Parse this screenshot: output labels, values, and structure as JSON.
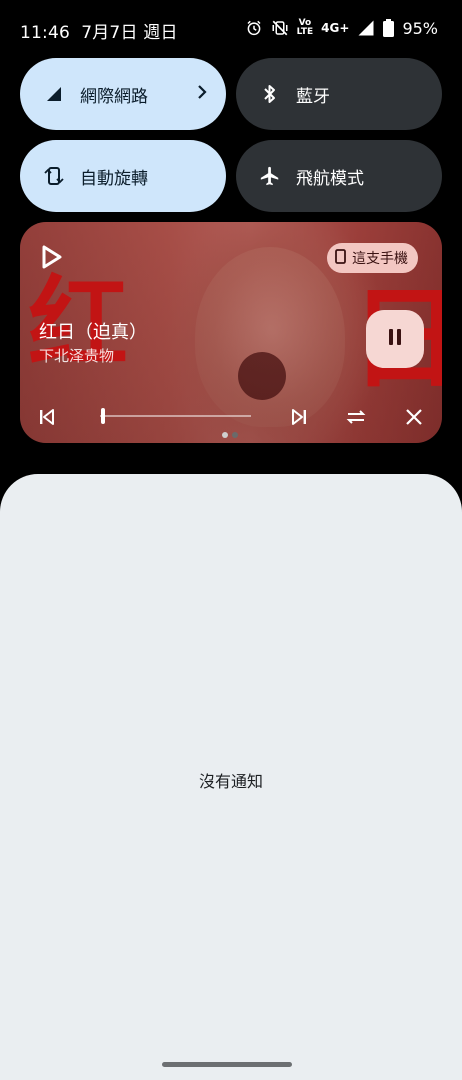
{
  "status_bar": {
    "time": "11:46",
    "date": "7月7日 週日",
    "network": "4G+",
    "battery": "95%",
    "icons": [
      "alarm-icon",
      "vibrate-off-icon",
      "volte-icon",
      "signal-icon",
      "battery-icon"
    ],
    "volte_top": "Vo",
    "volte_bottom": "LTE"
  },
  "quick_settings": {
    "tiles": [
      {
        "label": "網際網路",
        "state": "on",
        "icon": "cellular-signal-icon"
      },
      {
        "label": "藍牙",
        "state": "off",
        "icon": "bluetooth-icon"
      },
      {
        "label": "自動旋轉",
        "state": "on",
        "icon": "auto-rotate-icon"
      },
      {
        "label": "飛航模式",
        "state": "off",
        "icon": "airplane-icon"
      }
    ]
  },
  "media": {
    "title": "红日（迫真）",
    "artist": "下北泽贵物",
    "output_device": "這支手機",
    "artwork_char_left": "红",
    "artwork_char_right": "日",
    "progress_fraction": 0.02,
    "page_count": 2,
    "active_page": 0
  },
  "notifications": {
    "empty_text": "沒有通知"
  },
  "colors": {
    "tile_on": "#cfe6fb",
    "tile_off": "#2e3236",
    "panel_bg": "#eaeef1",
    "accent_red": "#c21414"
  }
}
